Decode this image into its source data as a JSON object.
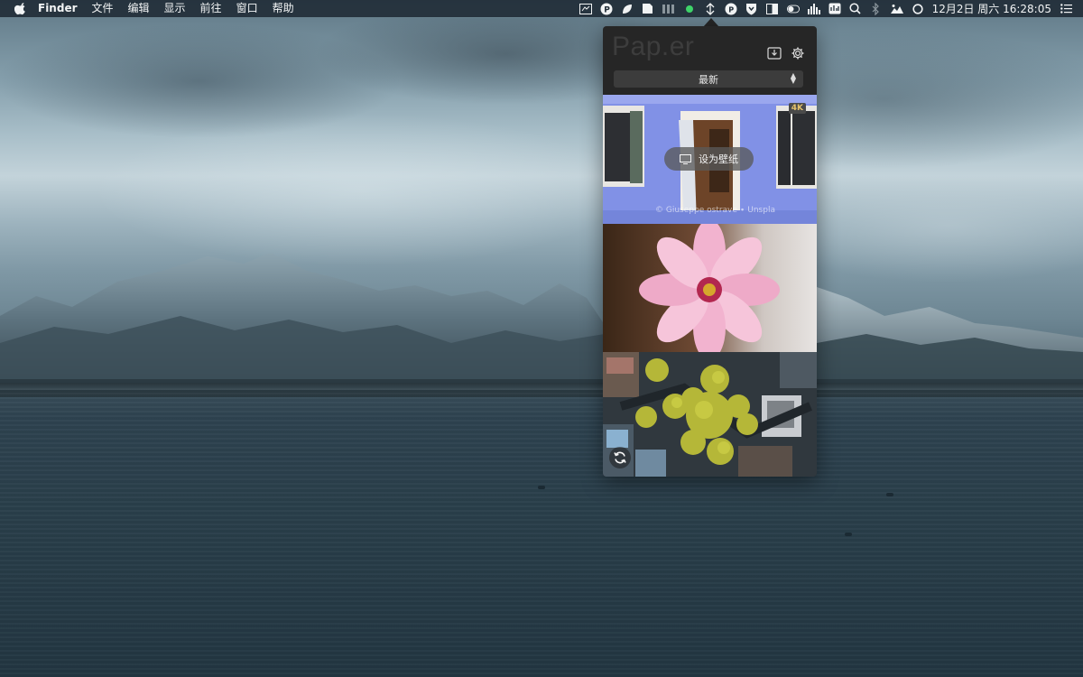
{
  "menubar": {
    "app_menu": "Finder",
    "items": [
      "文件",
      "编辑",
      "显示",
      "前往",
      "窗口",
      "帮助"
    ],
    "clock": "12月2日 周六  16:28:05",
    "status_icons": [
      "screen-icon",
      "paper-p-icon",
      "leaf-icon",
      "document-icon",
      "battery-bars-icon",
      "green-dot-icon",
      "network-arrow-icon",
      "paper-app-icon",
      "shield-icon",
      "sidebar-icon",
      "toggle-icon",
      "activity-icon",
      "stats-icon",
      "search-icon",
      "bluetooth-icon",
      "photo-icon",
      "circle-icon",
      "list-icon"
    ]
  },
  "popover": {
    "app_title": "Pap.er",
    "sort_select": {
      "value": "最新"
    },
    "thumbnails": [
      {
        "name": "blue-wall-door",
        "badge": "4K",
        "action_label": "设为壁纸",
        "credit": "© Giuseppe ostrave ∙ Unspla"
      },
      {
        "name": "pink-flower"
      },
      {
        "name": "aerial-city-trees"
      }
    ]
  },
  "colors": {
    "popover_bg": "#262626",
    "menubar_bg": "#222e38",
    "badge_text": "#e6c36a",
    "accent_green": "#3fd46a"
  }
}
